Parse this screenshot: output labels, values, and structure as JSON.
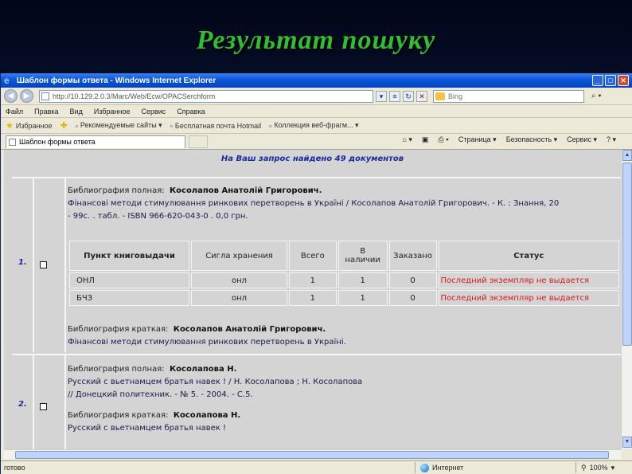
{
  "slide": {
    "title": "Результат пошуку"
  },
  "window": {
    "title": "Шаблон формы ответа - Windows Internet Explorer"
  },
  "address": {
    "url": "http://10.129.2.0.3/Marc/Web/Ecw/OPACSerchform",
    "search_placeholder": "Bing"
  },
  "menu": [
    "Файл",
    "Правка",
    "Вид",
    "Избранное",
    "Сервис",
    "Справка"
  ],
  "favorites": {
    "label": "Избранное",
    "items": [
      "Рекомендуемые сайты ▾",
      "Бесплатная почта Hotmail",
      "Коллекция веб-фрагм... ▾"
    ]
  },
  "tab": {
    "label": "Шаблон формы ответа"
  },
  "commands": [
    "Страница ▾",
    "Безопасность ▾",
    "Сервис ▾"
  ],
  "results": {
    "count_text": "На Ваш запрос найдено 49 документов",
    "records": [
      {
        "num": "1.",
        "full_label": "Библиография полная:",
        "full_author": "Косолапов Анатолій Григорович.",
        "full_line2": "Фінансові методи стимулювання ринкових перетворень в Україні / Косолапов Анатолій Григорович. - К. : Знання, 20",
        "full_line3": "- 99с. . табл. - ISBN 966-620-043-0 . 0,0 грн.",
        "holdings_headers": [
          "Пункт книговыдачи",
          "Сигла хранения",
          "Всего",
          "В наличии",
          "Заказано",
          "Статус"
        ],
        "holdings": [
          [
            "ОНЛ",
            "онл",
            "1",
            "1",
            "0",
            "Последний экземпляр не выдается"
          ],
          [
            "БЧЗ",
            "онл",
            "1",
            "1",
            "0",
            "Последний экземпляр не выдается"
          ]
        ],
        "short_label": "Библиография краткая:",
        "short_author": "Косолапов Анатолій Григорович.",
        "short_line2": "Фінансові методи стимулювання ринкових перетворень в Україні."
      },
      {
        "num": "2.",
        "full_label": "Библиография полная:",
        "full_author": "Косолапова Н.",
        "full_line2": "Русский с вьетнамцем братья навек ! / Н. Косолапова ; Н. Косолапова",
        "full_line3": "// Донецкий политехник. - № 5. - 2004. - С.5.",
        "short_label": "Библиография краткая:",
        "short_author": "Косолапова Н.",
        "short_line2": "Русский с вьетнамцем братья навек !"
      }
    ]
  },
  "status": {
    "left": "готово",
    "zone": "Интернет",
    "zoom": "100%"
  }
}
